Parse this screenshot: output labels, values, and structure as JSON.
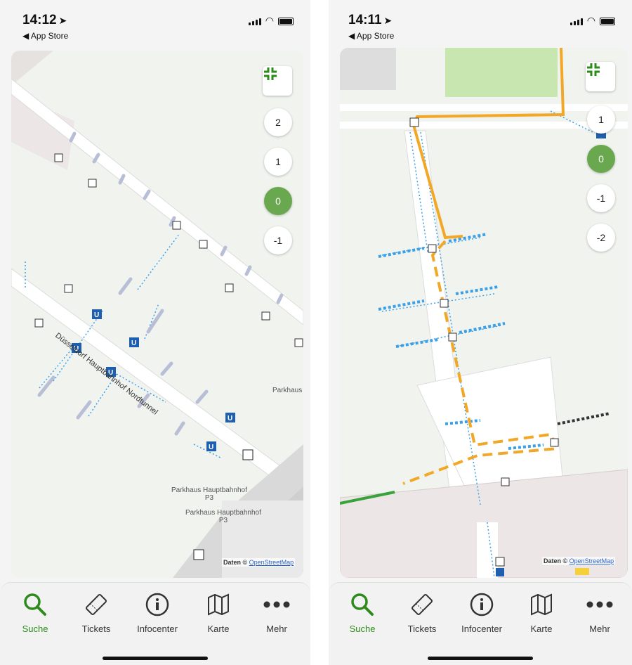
{
  "left": {
    "status": {
      "time": "14:12",
      "back": "App Store"
    },
    "levels": [
      "2",
      "1",
      "0",
      "-1"
    ],
    "active_level": "0",
    "map_labels": {
      "tunnel": "Düsseldorf Hauptbahnhof Nordtunnel",
      "parkhaus_edge": "Parkhaus",
      "parkhaus1": "Parkhaus Hauptbahnhof",
      "parkhaus1_sub": "P3",
      "parkhaus2": "Parkhaus Hauptbahnhof",
      "parkhaus2_sub": "P3"
    },
    "attribution": {
      "prefix": "Daten ©",
      "link": "OpenStreetMap"
    },
    "tabs": [
      "Suche",
      "Tickets",
      "Infocenter",
      "Karte",
      "Mehr"
    ]
  },
  "right": {
    "status": {
      "time": "14:11",
      "back": "App Store"
    },
    "levels": [
      "1",
      "0",
      "-1",
      "-2"
    ],
    "active_level": "0",
    "attribution": {
      "prefix": "Daten ©",
      "link": "OpenStreetMap"
    },
    "tabs": [
      "Suche",
      "Tickets",
      "Infocenter",
      "Karte",
      "Mehr"
    ]
  },
  "icons": {
    "collapse": "collapse-icon",
    "search": "search-icon",
    "tickets": "ticket-icon",
    "info": "info-icon",
    "map": "map-icon",
    "more": "more-icon"
  },
  "colors": {
    "accent": "#2e8a1c",
    "active_level": "#6aa84f",
    "route": "#f2a826",
    "ubahn": "#1f5fb0",
    "footpath": "#3aa0e8"
  }
}
